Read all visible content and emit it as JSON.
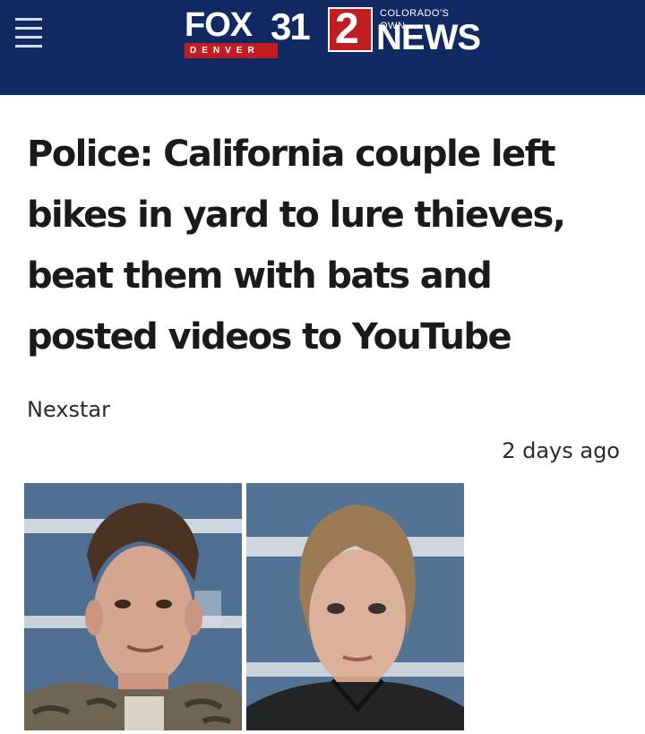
{
  "header": {
    "logo": {
      "fox": "FOX",
      "denver": "DENVER",
      "channel": "31",
      "number": "2",
      "tagline": "COLORADO'S OWN",
      "news": "NEWS"
    },
    "colors": {
      "background": "#112a63",
      "accent": "#c21d22"
    },
    "menu_icon": "hamburger-menu-icon"
  },
  "article": {
    "headline": "Police: California couple left bikes in yard to lure thieves, beat them with bats and posted videos to YouTube",
    "source": "Nexstar",
    "time": "2 days ago"
  },
  "photos": [
    {
      "subject": "male mugshot"
    },
    {
      "subject": "female mugshot"
    }
  ]
}
